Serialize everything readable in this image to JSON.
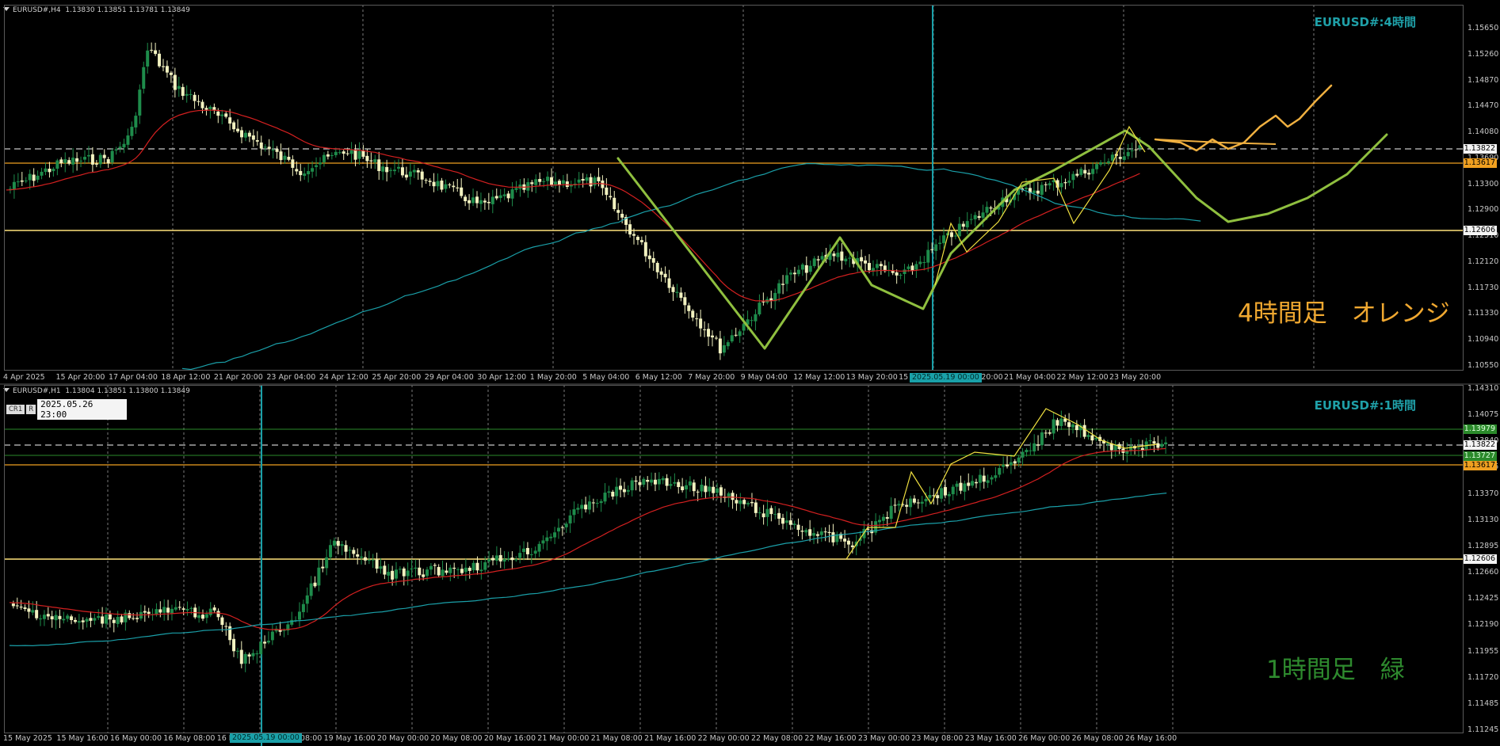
{
  "colors": {
    "background": "#000000",
    "grid": "#7a7a7a",
    "candle_up": "#1e8c4b",
    "candle_down": "#f2f2c0",
    "ma_fast": "#d42020",
    "ma_slow": "#1a9fa8",
    "level_orange": "#f0a020",
    "level_yellow": "#ffe27a",
    "level_dashed": "#c8c8c8",
    "level_green": "#2a8a2a",
    "vline": "#1aa0a8",
    "path_green": "#8fbf3f",
    "path_orange": "#f0b040",
    "zigzag_yellow": "#f0e040"
  },
  "h4": {
    "header": "EURUSD#,H4  1.13830 1.13851 1.13781 1.13849",
    "symbol_title": "EURUSD#:4時間",
    "note": "4時間足　オレンジ",
    "y_ticks": [
      "1.15650",
      "1.15260",
      "1.14870",
      "1.14470",
      "1.14080",
      "1.13690",
      "1.13300",
      "1.12900",
      "1.12510",
      "1.12120",
      "1.11730",
      "1.11330",
      "1.10940",
      "1.10550"
    ],
    "levels": {
      "dashed": "1.13822",
      "orange": "1.13617",
      "yellow": "1.12606"
    },
    "x_ticks": [
      "4 Apr 2025",
      "15 Apr 20:00",
      "17 Apr 04:00",
      "18 Apr 12:00",
      "21 Apr 20:00",
      "23 Apr 04:00",
      "24 Apr 12:00",
      "25 Apr 20:00",
      "29 Apr 04:00",
      "30 Apr 12:00",
      "1 May 20:00",
      "5 May 04:00",
      "6 May 12:00",
      "7 May 20:00",
      "9 May 04:00",
      "12 May 12:00",
      "13 May 20:00",
      "15 May 04:00",
      "19 May 20:00",
      "21 May 04:00",
      "22 May 12:00",
      "23 May 20:00"
    ],
    "time_cursor": "2025.05.19 00:00"
  },
  "h1": {
    "header": "EURUSD#,H1  1.13804 1.13851 1.13800 1.13849",
    "symbol_title": "EURUSD#:1時間",
    "note": "1時間足　緑",
    "crosshair_buttons": [
      "CR1",
      "R"
    ],
    "crosshair_time": "2025.05.26 23:00",
    "y_ticks": [
      "1.14310",
      "1.14075",
      "1.13840",
      "1.13605",
      "1.13370",
      "1.13130",
      "1.12895",
      "1.12660",
      "1.12425",
      "1.12190",
      "1.11955",
      "1.11720",
      "1.11485",
      "1.11245"
    ],
    "levels": {
      "green": "1.13979",
      "dashed": "1.13822",
      "green2": "1.13727",
      "orange": "1.13617",
      "yellow": "1.12606"
    },
    "x_ticks": [
      "15 May 2025",
      "15 May 16:00",
      "16 May 00:00",
      "16 May 08:00",
      "16 Ma",
      "19 May 08:00",
      "19 May 16:00",
      "20 May 00:00",
      "20 May 08:00",
      "20 May 16:00",
      "21 May 00:00",
      "21 May 08:00",
      "21 May 16:00",
      "22 May 00:00",
      "22 May 08:00",
      "22 May 16:00",
      "23 May 00:00",
      "23 May 08:00",
      "23 May 16:00",
      "26 May 00:00",
      "26 May 08:00",
      "26 May 16:00"
    ],
    "time_cursor": "2025.05.19 00:00"
  }
}
